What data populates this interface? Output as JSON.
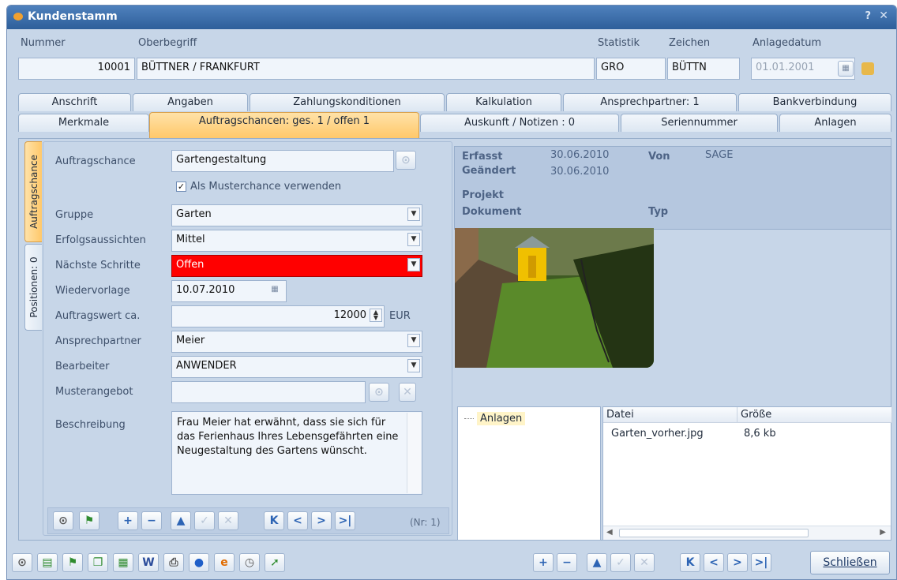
{
  "window": {
    "title": "Kundenstamm",
    "help": "?",
    "close": "✕"
  },
  "header": {
    "nummer_label": "Nummer",
    "nummer": "10001",
    "oberbegriff_label": "Oberbegriff",
    "oberbegriff": "BÜTTNER / FRANKFURT",
    "statistik_label": "Statistik",
    "statistik": "GRO",
    "zeichen_label": "Zeichen",
    "zeichen": "BÜTTN",
    "anlagedatum_label": "Anlagedatum",
    "anlagedatum": "01.01.2001"
  },
  "tabs_row1": [
    "Anschrift",
    "Angaben",
    "Zahlungskonditionen",
    "Kalkulation",
    "Ansprechpartner: 1",
    "Bankverbindung"
  ],
  "tabs_row2": [
    "Merkmale",
    "Auftragschancen: ges. 1 / offen 1",
    "Auskunft / Notizen : 0",
    "Seriennummer",
    "Anlagen"
  ],
  "vtabs": [
    "Auftragschance",
    "Positionen: 0"
  ],
  "form": {
    "auftragschance_label": "Auftragschance",
    "auftragschance": "Gartengestaltung",
    "muster_label": "Als Musterchance verwenden",
    "gruppe_label": "Gruppe",
    "gruppe": "Garten",
    "erfolg_label": "Erfolgsaussichten",
    "erfolg": "Mittel",
    "naechste_label": "Nächste Schritte",
    "naechste": "Offen",
    "wieder_label": "Wiedervorlage",
    "wieder": "10.07.2010",
    "wert_label": "Auftragswert ca.",
    "wert": "12000",
    "waehrung": "EUR",
    "ansprech_label": "Ansprechpartner",
    "ansprech": "Meier",
    "bearbeiter_label": "Bearbeiter",
    "bearbeiter": "ANWENDER",
    "muster_angebot_label": "Musterangebot",
    "muster_angebot": "",
    "beschreibung_label": "Beschreibung",
    "beschreibung": "Frau Meier hat erwähnt, dass sie sich für das Ferienhaus Ihres Lebensgefährten eine Neugestaltung des Gartens wünscht."
  },
  "record_nr": "(Nr: 1)",
  "info": {
    "erfasst_label": "Erfasst",
    "erfasst": "30.06.2010",
    "von_label": "Von",
    "von": "SAGE",
    "geaendert_label": "Geändert",
    "geaendert": "30.06.2010",
    "projekt_label": "Projekt",
    "dokument_label": "Dokument",
    "typ_label": "Typ"
  },
  "attachments": {
    "tree_item": "Anlagen",
    "col_datei": "Datei",
    "col_groesse": "Größe",
    "rows": [
      {
        "datei": "Garten_vorher.jpg",
        "groesse": "8,6 kb"
      }
    ]
  },
  "close_button": "Schließen"
}
